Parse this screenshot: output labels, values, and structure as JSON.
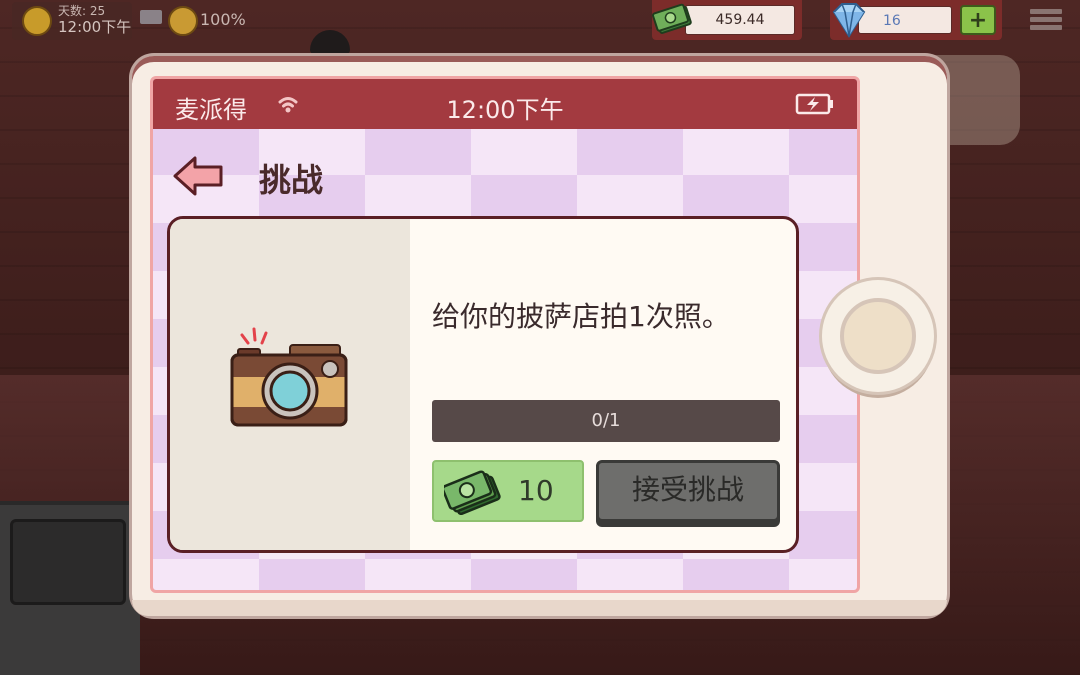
{
  "hud": {
    "days_label": "天数: 25",
    "clock": "12:00下午",
    "happiness": "100%",
    "money": "459.44",
    "gems": "16",
    "add_label": "+"
  },
  "phone": {
    "carrier": "麦派得",
    "time": "12:00下午",
    "title": "挑战"
  },
  "challenge": {
    "description": "给你的披萨店拍1次照。",
    "progress_text": "0/1",
    "progress_fraction": 0,
    "reward_amount": "10",
    "accept_label": "接受挑战",
    "icon": "camera-icon"
  },
  "colors": {
    "status_bar": "#a33a40",
    "reward_bg": "#a6d98a",
    "accept_bg": "#6e6e6c",
    "progress_bg": "#564948"
  }
}
